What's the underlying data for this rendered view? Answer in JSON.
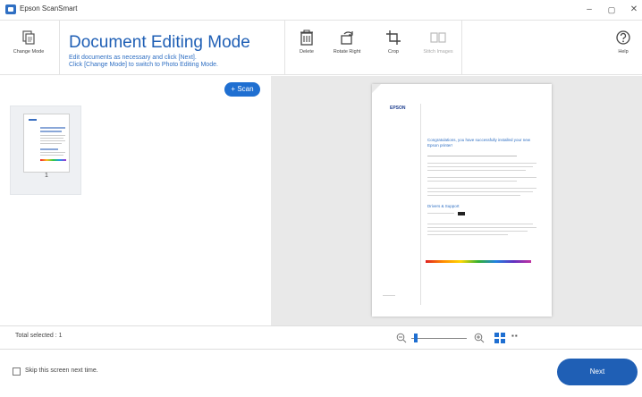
{
  "window": {
    "title": "Epson ScanSmart",
    "minimize": "–",
    "maximize": "▢",
    "close": "✕"
  },
  "toolbar": {
    "change_mode": "Change Mode",
    "delete": "Delete",
    "rotate_right": "Rotate Right",
    "crop": "Crop",
    "stitch_images": "Stitch Images",
    "help": "Help"
  },
  "mode": {
    "title": "Document Editing Mode",
    "desc_line1": "Edit documents as necessary and click [Next].",
    "desc_line2": "Click [Change Mode] to switch to Photo Editing Mode."
  },
  "scan_button": "+ Scan",
  "thumbnails": [
    {
      "number": "1"
    }
  ],
  "status": {
    "total_selected": "Total selected : 1",
    "zoom_level": 0.05
  },
  "footer": {
    "skip_label": "Skip this screen next time.",
    "skip_checked": false,
    "next_label": "Next"
  },
  "document": {
    "logo": "EPSON",
    "heading": "Congratulations, you have successfully installed your new Epson printer!",
    "section": "Drivers & Support"
  },
  "colors": {
    "accent": "#1f5fb5",
    "scan_button": "#1f6fd1",
    "preview_bg": "#e9e9e9"
  }
}
